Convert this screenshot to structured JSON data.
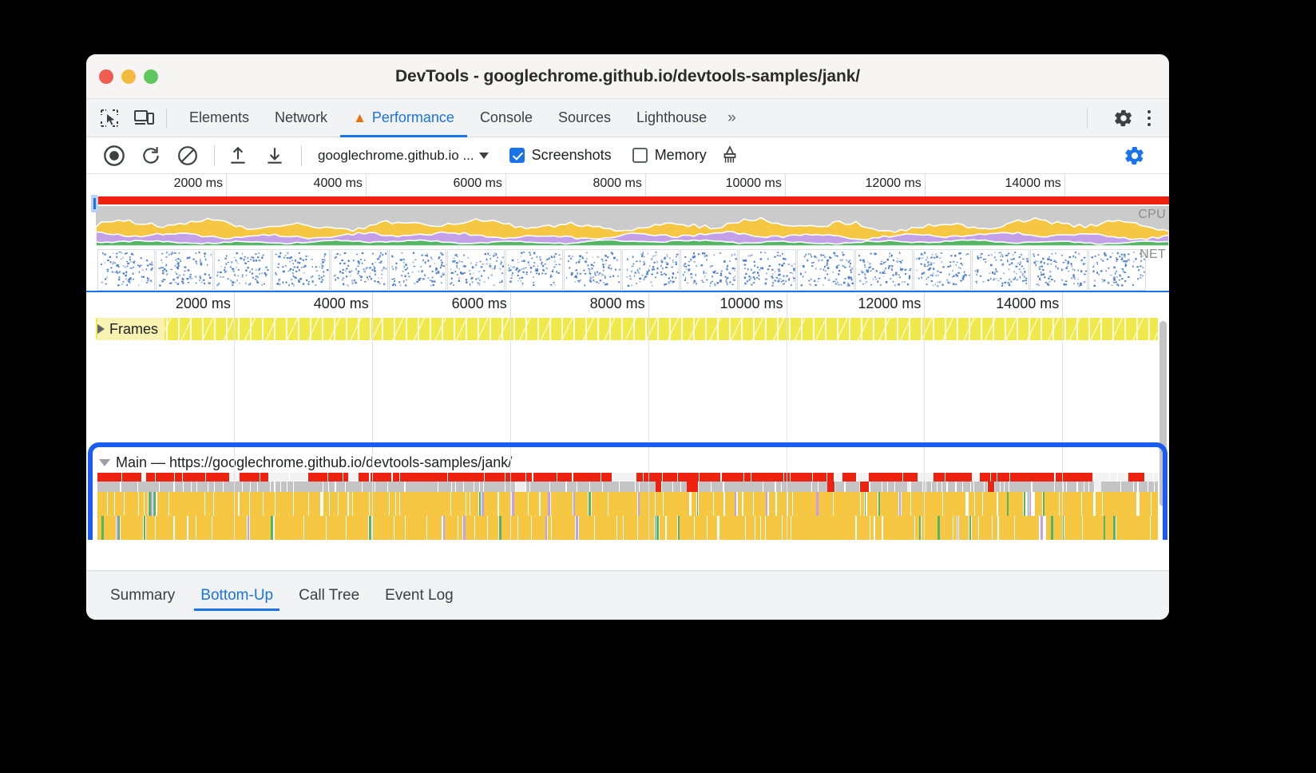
{
  "window": {
    "title": "DevTools - googlechrome.github.io/devtools-samples/jank/",
    "traffic_lights": [
      "close-red",
      "minimize-yellow",
      "maximize-green"
    ]
  },
  "toolbar": {
    "inspect_icon": "inspect-element-icon",
    "device_icon": "device-toolbar-icon",
    "tabs": [
      {
        "label": "Elements",
        "active": false,
        "warning": false
      },
      {
        "label": "Network",
        "active": false,
        "warning": false
      },
      {
        "label": "Performance",
        "active": true,
        "warning": true
      },
      {
        "label": "Console",
        "active": false,
        "warning": false
      },
      {
        "label": "Sources",
        "active": false,
        "warning": false
      },
      {
        "label": "Lighthouse",
        "active": false,
        "warning": false
      }
    ],
    "more_tabs": "»",
    "settings_icon": "gear-icon",
    "menu_icon": "kebab-menu-icon"
  },
  "controls": {
    "record_icon": "record-circle-icon",
    "reload_icon": "reload-and-record-icon",
    "clear_icon": "clear-recording-icon",
    "upload_icon": "load-profile-icon",
    "download_icon": "save-profile-icon",
    "session_select": "googlechrome.github.io ...",
    "screenshots": {
      "label": "Screenshots",
      "checked": true
    },
    "memory": {
      "label": "Memory",
      "checked": false
    },
    "gc_icon": "collect-garbage-icon",
    "capture_settings_icon": "capture-settings-gear-icon"
  },
  "overview": {
    "ticks": [
      "2000 ms",
      "4000 ms",
      "6000 ms",
      "8000 ms",
      "10000 ms",
      "12000 ms",
      "14000 ms"
    ],
    "cpu_label": "CPU",
    "net_label": "NET"
  },
  "timeline": {
    "ticks": [
      "2000 ms",
      "4000 ms",
      "6000 ms",
      "8000 ms",
      "10000 ms",
      "12000 ms",
      "14000 ms"
    ],
    "frames_track": "Frames",
    "main_track": "Main — https://googlechrome.github.io/devtools-samples/jank/",
    "frames_expanded": false,
    "main_expanded": true
  },
  "bottom_tabs": [
    {
      "label": "Summary",
      "active": false
    },
    {
      "label": "Bottom-Up",
      "active": true
    },
    {
      "label": "Call Tree",
      "active": false
    },
    {
      "label": "Event Log",
      "active": false
    }
  ],
  "colors": {
    "accent": "#1a73e8",
    "highlight_outline": "#1a5cf0",
    "warning": "#e8710a",
    "scripting_yellow": "#f5c742",
    "rendering_purple": "#c4a0e8",
    "painting_green": "#54b567",
    "loading_blue": "#c8d9ec",
    "long_task_red": "#ee2211",
    "system_gray": "#c4c4c4",
    "frames_yellow": "#f0e94c"
  }
}
